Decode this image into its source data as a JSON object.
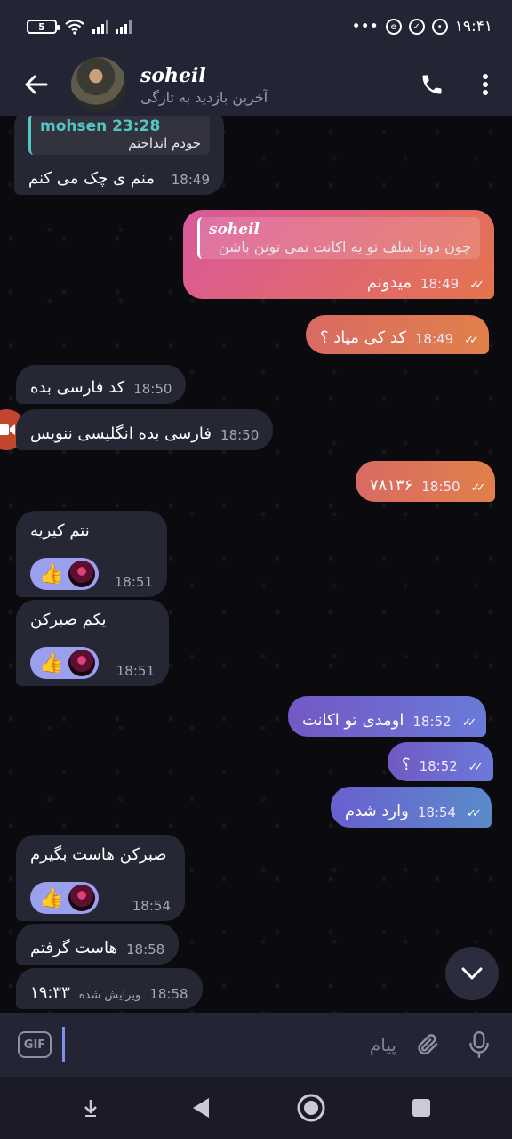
{
  "status_bar": {
    "battery": "5",
    "time": "۱۹:۴۱",
    "dots": "•••"
  },
  "header": {
    "contact_name": "soheil",
    "contact_status": "آخرین بازدید به تازگی"
  },
  "messages": [
    {
      "id": "m1",
      "reply_name": "mohsen 23:28",
      "reply_text": "خودم انداختم",
      "text": "منم ی چک می کنم",
      "time": "18:49"
    },
    {
      "id": "m2",
      "reply_name": "soheil",
      "reply_text": "چون دوتا سلف تو یه اکانت نمی تونن باشن",
      "text": "میدونم",
      "time": "18:49",
      "status": "✓✓"
    },
    {
      "id": "m3",
      "text": "کد کی میاد ؟",
      "time": "18:49",
      "status": "✓✓"
    },
    {
      "id": "m4",
      "text": "کد فارسی بده",
      "time": "18:50"
    },
    {
      "id": "m5",
      "text": "فارسی بده انگلیسی ننویس",
      "time": "18:50"
    },
    {
      "id": "m6",
      "text": "۷۸۱۳۶",
      "time": "18:50",
      "status": "✓✓"
    },
    {
      "id": "m7",
      "text": "نتم کیریه",
      "time": "18:51",
      "reaction": "👍"
    },
    {
      "id": "m8",
      "text": "یکم صبرکن",
      "time": "18:51",
      "reaction": "👍"
    },
    {
      "id": "m9",
      "text": "اومدی تو اکانت",
      "time": "18:52",
      "status": "✓✓"
    },
    {
      "id": "m10",
      "text": "؟",
      "time": "18:52",
      "status": "✓✓"
    },
    {
      "id": "m11",
      "text": "وارد شدم",
      "time": "18:54",
      "status": "✓✓"
    },
    {
      "id": "m12",
      "text": "صبرکن هاست بگیرم",
      "time": "18:54",
      "reaction": "👍"
    },
    {
      "id": "m13",
      "text": "هاست گرفتم",
      "time": "18:58"
    },
    {
      "id": "m14",
      "text": "۱۹:۳۳",
      "edited": "ویرایش شده",
      "time": "18:58"
    }
  ],
  "composer": {
    "gif_label": "GIF",
    "placeholder": "پیام"
  },
  "colors": {
    "accent": "#54c6c2",
    "header_bg": "#232434",
    "incoming_bubble": "#262734",
    "outgoing_orange": "#e0804a",
    "outgoing_purple": "#7358c4"
  }
}
